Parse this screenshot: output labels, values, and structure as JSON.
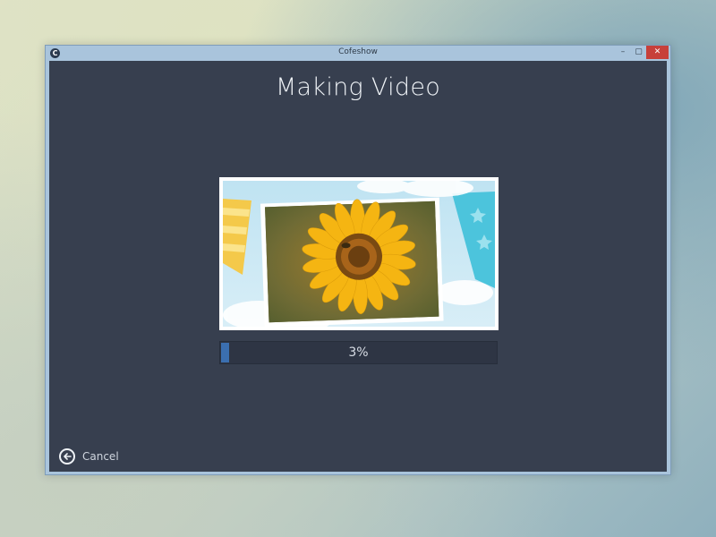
{
  "window": {
    "title": "Cofeshow",
    "app_icon_letter": "C",
    "controls": {
      "minimize": "–",
      "maximize": "▢",
      "close": "✕"
    }
  },
  "main": {
    "heading": "Making Video",
    "preview": {
      "icon": "sunflower-photo-thumbnail"
    },
    "progress": {
      "percent": 3,
      "label": "3%"
    },
    "cancel": {
      "label": "Cancel",
      "icon": "back-arrow-circle-icon"
    }
  },
  "colors": {
    "background": "#373f4f",
    "accent": "#3b6fb0",
    "close_button": "#c7403a"
  }
}
